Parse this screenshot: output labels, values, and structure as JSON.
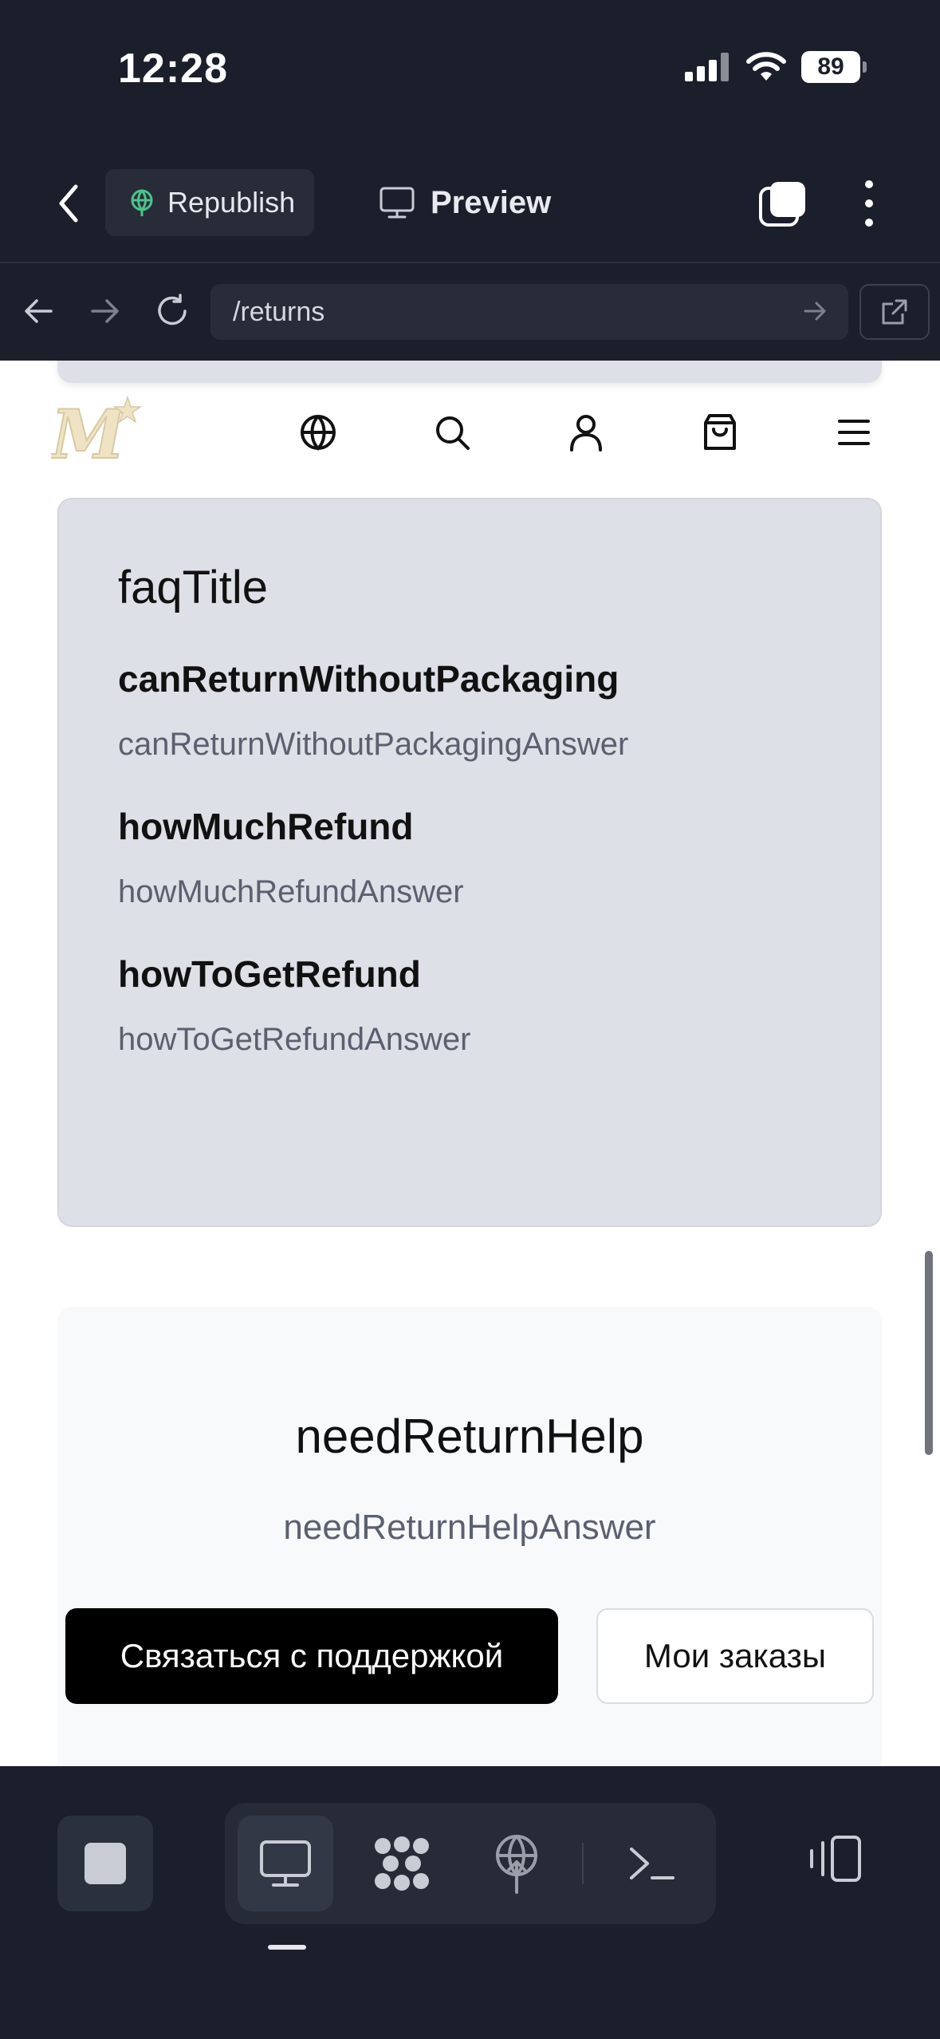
{
  "status_bar": {
    "time": "12:28",
    "battery": "89",
    "icons": [
      "signal-icon",
      "wifi-icon",
      "battery-icon"
    ]
  },
  "toolbar": {
    "republish_label": "Republish",
    "preview_label": "Preview",
    "icons": [
      "chevron-left-icon",
      "globe-icon",
      "monitor-icon",
      "windows-icon",
      "more-vertical-icon"
    ]
  },
  "url_bar": {
    "url": "/returns",
    "icons": [
      "arrow-left-icon",
      "arrow-right-icon",
      "reload-icon",
      "go-arrow-icon",
      "external-link-icon"
    ]
  },
  "site_header": {
    "logo_alt": "M",
    "icons": [
      "globe-icon",
      "search-icon",
      "user-icon",
      "shopping-bag-icon",
      "hamburger-menu-icon"
    ]
  },
  "faq": {
    "title": "faqTitle",
    "items": [
      {
        "question": "canReturnWithoutPackaging",
        "answer": "canReturnWithoutPackagingAnswer"
      },
      {
        "question": "howMuchRefund",
        "answer": "howMuchRefundAnswer"
      },
      {
        "question": "howToGetRefund",
        "answer": "howToGetRefundAnswer"
      }
    ]
  },
  "help": {
    "title": "needReturnHelp",
    "subtitle": "needReturnHelpAnswer",
    "support_button": "Связаться с поддержкой",
    "orders_button": "Мои заказы"
  },
  "bottom_bar": {
    "icons": [
      "stop-icon",
      "monitor-icon",
      "nodes-icon",
      "deploy-icon",
      "terminal-icon",
      "device-toggle-icon"
    ],
    "active_tab": "monitor"
  },
  "colors": {
    "chrome_bg": "#1b1f2b",
    "card_bg": "#dde0e6",
    "primary_button": "#000000",
    "republish_accent": "#4cc38a"
  }
}
